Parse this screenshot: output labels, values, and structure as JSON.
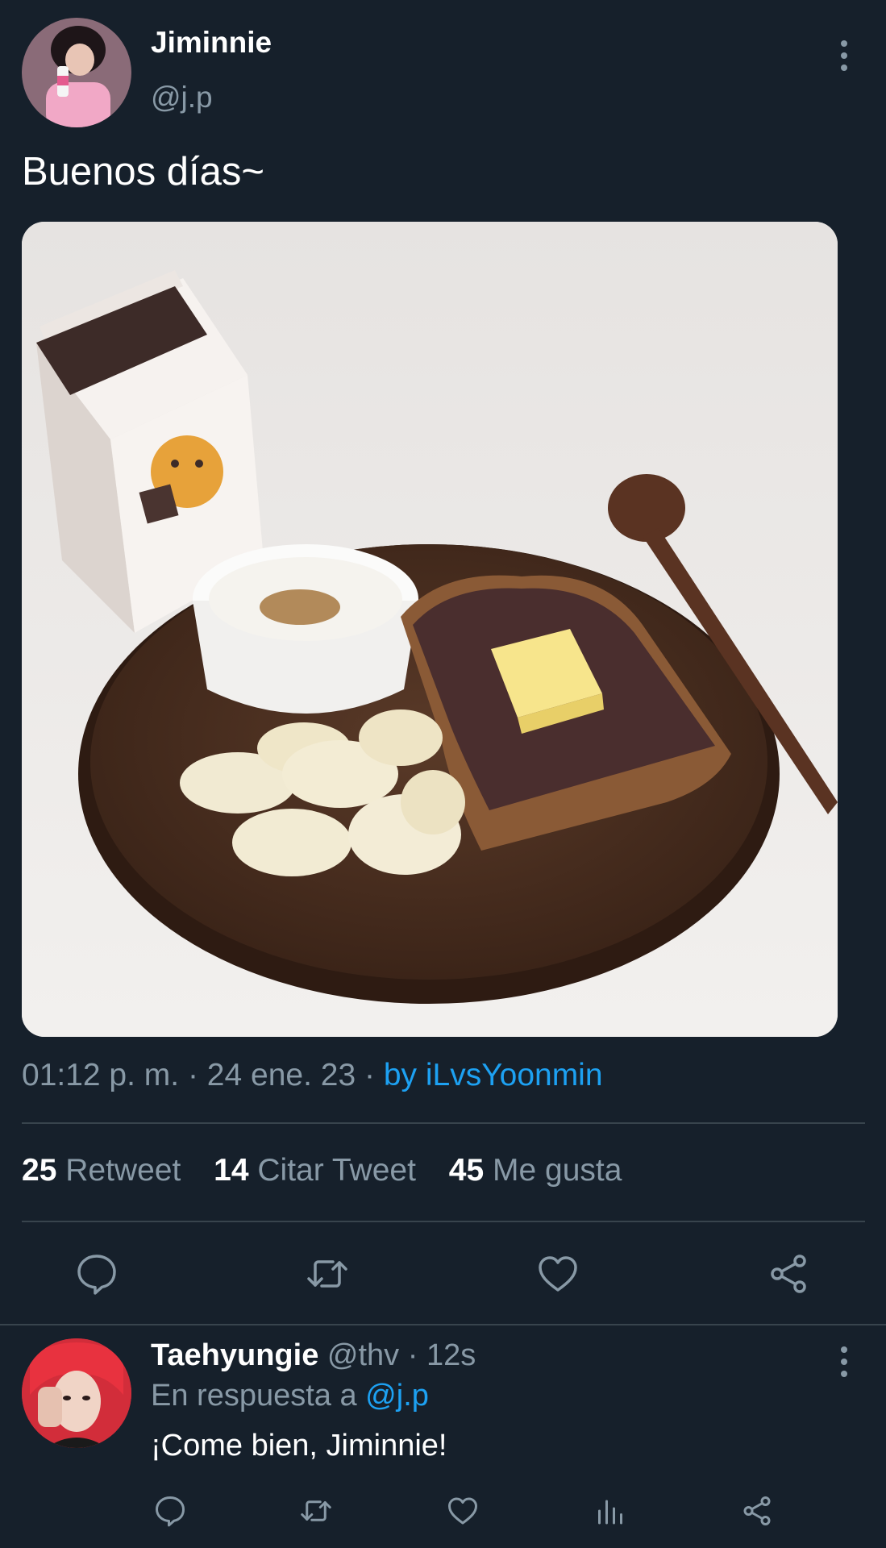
{
  "tweet": {
    "author_name": "Jiminnie",
    "author_handle": "@j.p",
    "text": "Buenos días~",
    "time": "01:12 p. m.",
    "sep1": " · ",
    "date": "24 ene. 23",
    "sep2": " · ",
    "source": "by iLvsYoonmin"
  },
  "stats": {
    "retweets_count": "25",
    "retweets_label": "Retweet",
    "quotes_count": "14",
    "quotes_label": "Citar Tweet",
    "likes_count": "45",
    "likes_label": "Me gusta"
  },
  "reply": {
    "author_name": "Taehyungie",
    "author_handle": "@thv",
    "time": " · 12s",
    "in_reply_prefix": "En respuesta a ",
    "in_reply_handle": "@j.p",
    "text": "¡Come bien, Jiminnie!"
  },
  "colors": {
    "background": "#16202b",
    "accent": "#1da1f2",
    "muted": "#8899a6",
    "divider": "#38444d"
  },
  "icons": {
    "reply": "reply-icon",
    "retweet": "retweet-icon",
    "like": "heart-icon",
    "share": "share-icon",
    "analytics": "analytics-icon",
    "more": "more-vertical-icon"
  }
}
